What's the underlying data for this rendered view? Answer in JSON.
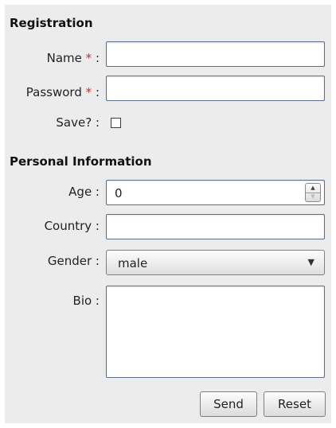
{
  "registration": {
    "title": "Registration",
    "name_label": "Name",
    "name_value": "",
    "password_label": "Password",
    "password_value": "",
    "save_label": "Save? :",
    "save_checked": false,
    "required_mark": "*",
    "colon": ":"
  },
  "personal": {
    "title": "Personal Information",
    "age_label": "Age :",
    "age_value": "0",
    "country_label": "Country :",
    "country_value": "",
    "gender_label": "Gender :",
    "gender_value": "male",
    "bio_label": "Bio :",
    "bio_value": ""
  },
  "actions": {
    "send_label": "Send",
    "reset_label": "Reset"
  },
  "icons": {
    "spinner_up": "triangle-up-icon",
    "spinner_down": "triangle-down-icon",
    "dropdown": "chevron-down-icon"
  },
  "colors": {
    "required": "#d12a2a",
    "panel_bg": "#ececec",
    "field_border": "#5a6f86"
  }
}
